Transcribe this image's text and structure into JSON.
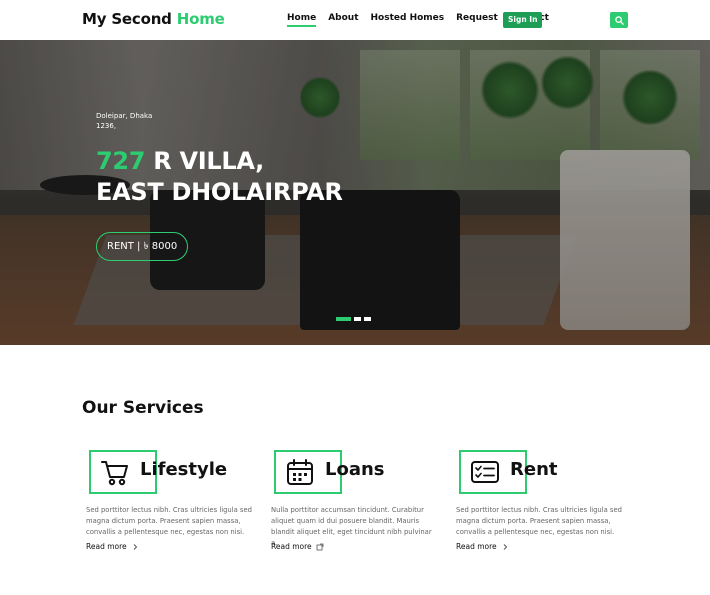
{
  "brand": {
    "name_part1": "My Second ",
    "name_part2": "Home",
    "accent_color": "#2ecc71"
  },
  "nav": {
    "items": [
      {
        "label": "Home",
        "active": true
      },
      {
        "label": "About",
        "active": false
      },
      {
        "label": "Hosted Homes",
        "active": false
      },
      {
        "label": "Request",
        "active": false
      },
      {
        "label": "Contact",
        "active": false
      }
    ],
    "signin_label": "Sign In",
    "search_icon": "search-icon"
  },
  "hero": {
    "address_line1": "Doleipar, Dhaka",
    "address_line2": "1236,",
    "title_number": "727",
    "title_rest": " R VILLA,",
    "title_line2": "EAST DHOLAIRPAR",
    "price": "RENT | ৳ 8000",
    "slides": [
      true,
      false,
      false
    ]
  },
  "services": {
    "heading": "Our Services",
    "cards": [
      {
        "title": "Lifestyle",
        "icon": "shopping-cart-icon",
        "text": "Sed porttitor lectus nibh. Cras ultricies ligula sed magna dictum porta. Praesent sapien massa, convallis a pellentesque nec, egestas non nisi.",
        "link": "Read more"
      },
      {
        "title": "Loans",
        "icon": "calendar-icon",
        "text": "Nulla porttitor accumsan tincidunt. Curabitur aliquet quam id dui posuere blandit. Mauris blandit aliquet elit, eget tincidunt nibh pulvinar a.",
        "link": "Read more"
      },
      {
        "title": "Rent",
        "icon": "checklist-icon",
        "text": "Sed porttitor lectus nibh. Cras ultricies ligula sed magna dictum porta. Praesent sapien massa, convallis a pellentesque nec, egestas non nisi.",
        "link": "Read more"
      }
    ]
  }
}
